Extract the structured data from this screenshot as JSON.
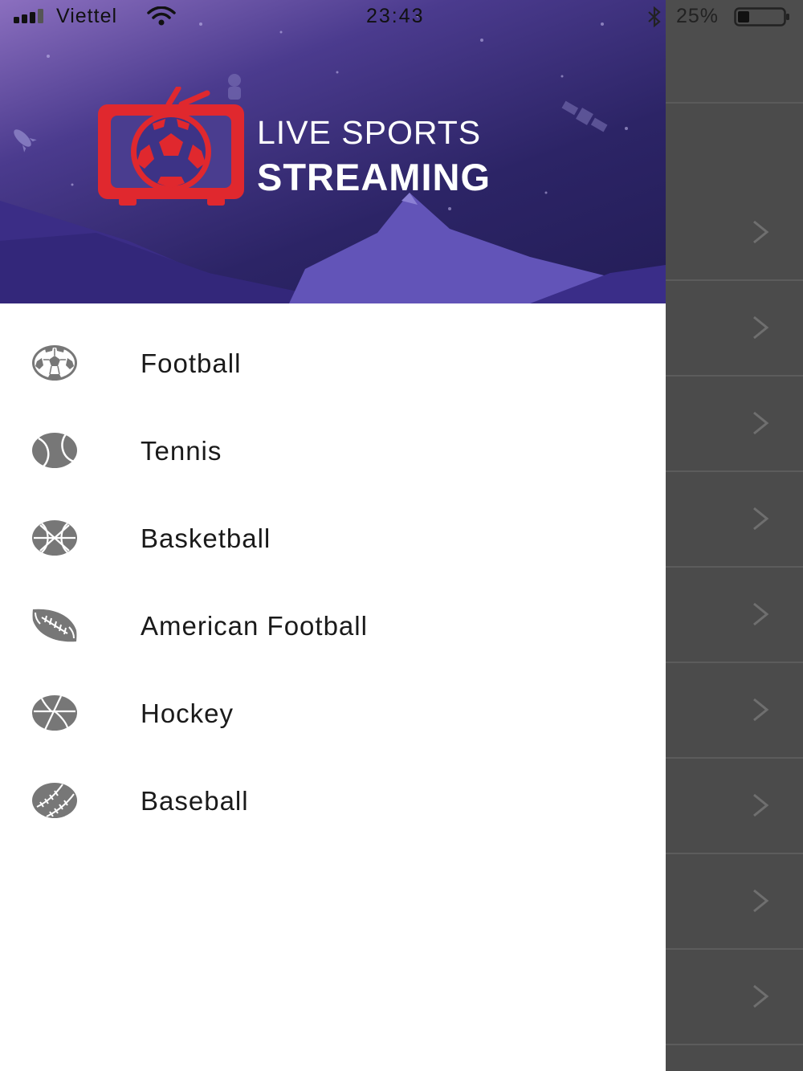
{
  "status_bar": {
    "carrier": "Viettel",
    "time": "23:43",
    "battery_percent": "25%",
    "battery_level": 0.25
  },
  "header": {
    "title_line1": "LIVE SPORTS",
    "title_line2": "STREAMING"
  },
  "menu": {
    "items": [
      {
        "label": "Football",
        "icon": "soccer-ball-icon"
      },
      {
        "label": "Tennis",
        "icon": "tennis-ball-icon"
      },
      {
        "label": "Basketball",
        "icon": "basketball-icon"
      },
      {
        "label": "American Football",
        "icon": "american-football-icon"
      },
      {
        "label": "Hockey",
        "icon": "hockey-puck-icon"
      },
      {
        "label": "Baseball",
        "icon": "baseball-icon"
      }
    ]
  },
  "colors": {
    "logo_red": "#e0282e",
    "header_purple": "#2c2466",
    "mountain": "#5a4fb0",
    "icon_gray": "#777777",
    "overlay_gray": "#4b4b4b"
  }
}
